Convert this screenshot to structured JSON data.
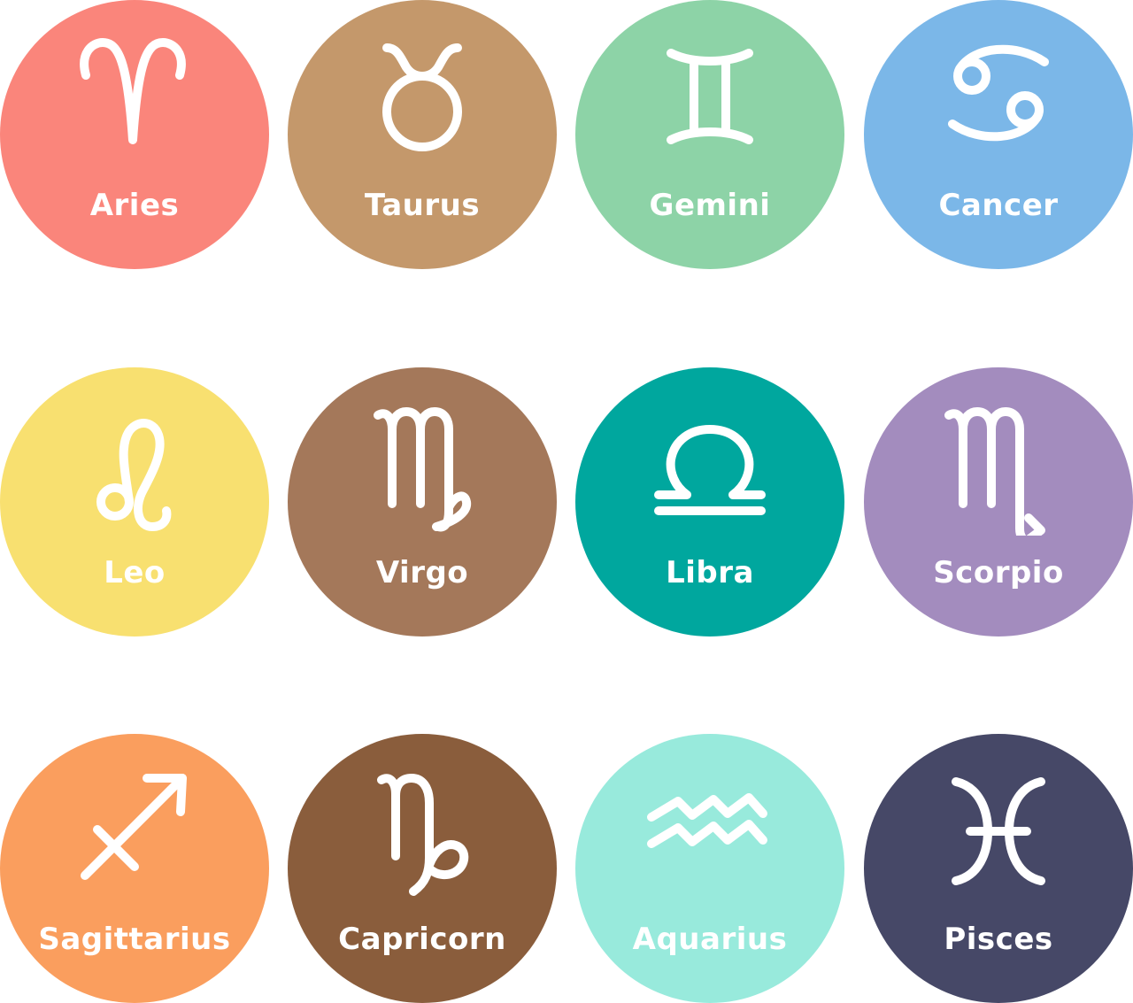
{
  "signs": [
    {
      "label": "Aries",
      "icon": "aries-icon",
      "color": "#FA857B"
    },
    {
      "label": "Taurus",
      "icon": "taurus-icon",
      "color": "#C4986B"
    },
    {
      "label": "Gemini",
      "icon": "gemini-icon",
      "color": "#8DD3A7"
    },
    {
      "label": "Cancer",
      "icon": "cancer-icon",
      "color": "#7BB7E8"
    },
    {
      "label": "Leo",
      "icon": "leo-icon",
      "color": "#F8E070"
    },
    {
      "label": "Virgo",
      "icon": "virgo-icon",
      "color": "#A4785A"
    },
    {
      "label": "Libra",
      "icon": "libra-icon",
      "color": "#00A79E"
    },
    {
      "label": "Scorpio",
      "icon": "scorpio-icon",
      "color": "#A38CBE"
    },
    {
      "label": "Sagittarius",
      "icon": "sagittarius-icon",
      "color": "#FA9E5E"
    },
    {
      "label": "Capricorn",
      "icon": "capricorn-icon",
      "color": "#8A5D3C"
    },
    {
      "label": "Aquarius",
      "icon": "aquarius-icon",
      "color": "#98EADC"
    },
    {
      "label": "Pisces",
      "icon": "pisces-icon",
      "color": "#464867"
    }
  ]
}
